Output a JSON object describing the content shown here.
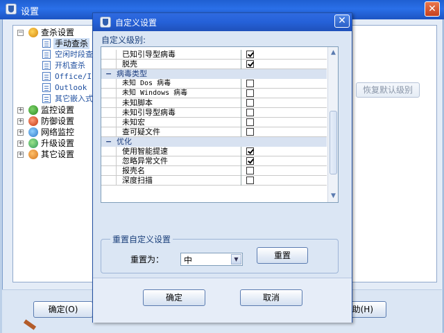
{
  "main_window": {
    "title": "设置",
    "close_label": "✕"
  },
  "tree": {
    "items": [
      {
        "label": "查杀设置",
        "expander": "−"
      },
      {
        "label": "手动查杀"
      },
      {
        "label": "空闲时段查"
      },
      {
        "label": "开机查杀"
      },
      {
        "label": "Office/IE"
      },
      {
        "label": "Outlook"
      },
      {
        "label": "其它嵌入式"
      },
      {
        "label": "监控设置",
        "expander": "+"
      },
      {
        "label": "防御设置",
        "expander": "+"
      },
      {
        "label": "网络监控",
        "expander": "+"
      },
      {
        "label": "升级设置",
        "expander": "+"
      },
      {
        "label": "其它设置",
        "expander": "+"
      }
    ]
  },
  "right_panel": {
    "restore_default_label": "恢复默认级别"
  },
  "main_buttons": {
    "ok_label": "确定(O)",
    "help_label": "助(H)"
  },
  "dialog": {
    "title": "自定义设置",
    "close_label": "✕",
    "section_label": "自定义级别:",
    "rows": [
      {
        "type": "item",
        "label": "已知引导型病毒",
        "checked": true
      },
      {
        "type": "item",
        "label": "脱壳",
        "checked": true
      },
      {
        "type": "group",
        "label": "病毒类型",
        "toggle": "−"
      },
      {
        "type": "item",
        "label": "未知 Dos 病毒",
        "checked": false
      },
      {
        "type": "item",
        "label": "未知 Windows 病毒",
        "checked": false
      },
      {
        "type": "item",
        "label": "未知脚本",
        "checked": false
      },
      {
        "type": "item",
        "label": "未知引导型病毒",
        "checked": false
      },
      {
        "type": "item",
        "label": "未知宏",
        "checked": false
      },
      {
        "type": "item",
        "label": "查可疑文件",
        "checked": false
      },
      {
        "type": "group",
        "label": "优化",
        "toggle": "−"
      },
      {
        "type": "item",
        "label": "使用智能提速",
        "checked": true
      },
      {
        "type": "item",
        "label": "忽略异常文件",
        "checked": true
      },
      {
        "type": "item",
        "label": "报壳名",
        "checked": false
      },
      {
        "type": "item",
        "label": "深度扫描",
        "checked": false
      }
    ],
    "reset_group": {
      "title": "重置自定义设置",
      "reset_to_label": "重置为：",
      "level_value": "中",
      "reset_button": "重置"
    },
    "ok_button": "确定",
    "cancel_button": "取消"
  }
}
